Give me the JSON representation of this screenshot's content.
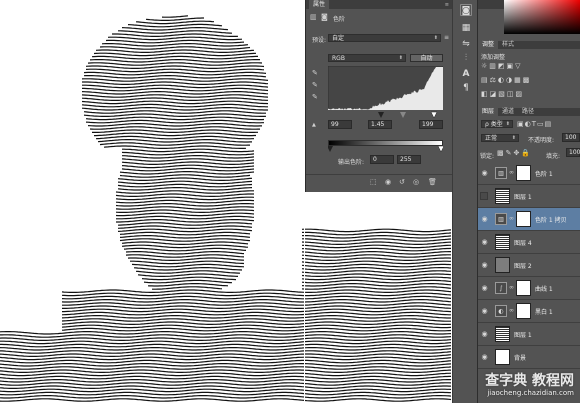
{
  "properties_panel": {
    "tab_label": "属性",
    "panel_icon_1": "adjustment-icon",
    "panel_icon_2": "mask-icon",
    "adjustment_name": "色阶",
    "preset_label": "预设:",
    "preset_value": "自定",
    "channel_value": "RGB",
    "auto_button": "自动",
    "input_black": "99",
    "input_gamma": "1.45",
    "input_white": "199",
    "output_label": "输出色阶:",
    "output_black": "0",
    "output_white": "255"
  },
  "adjustments_panel": {
    "tabs": [
      "调整",
      "样式"
    ],
    "add_label": "添加调整"
  },
  "layers_panel": {
    "tabs": [
      "图层",
      "通道",
      "路径"
    ],
    "filter_label": "ρ 类型",
    "blend_mode": "正常",
    "opacity_label": "不透明度:",
    "opacity_value": "100",
    "lock_label": "锁定:",
    "fill_label": "填充:",
    "fill_value": "100",
    "layers": [
      {
        "name": "色阶 1",
        "kind": "adjustment",
        "visible": true,
        "selected": false
      },
      {
        "name": "图层 1",
        "kind": "photo",
        "visible": false,
        "selected": false
      },
      {
        "name": "色阶 1 拷贝",
        "kind": "adjustment",
        "visible": true,
        "selected": true
      },
      {
        "name": "图层 4",
        "kind": "photo",
        "visible": true,
        "selected": false
      },
      {
        "name": "图层 2",
        "kind": "gray",
        "visible": true,
        "selected": false
      },
      {
        "name": "曲线 1",
        "kind": "curves",
        "visible": true,
        "selected": false
      },
      {
        "name": "黑白 1",
        "kind": "bw",
        "visible": true,
        "selected": false
      },
      {
        "name": "图层 1",
        "kind": "photo",
        "visible": true,
        "selected": false
      },
      {
        "name": "背景",
        "kind": "white",
        "visible": true,
        "selected": false
      }
    ]
  },
  "watermark": {
    "site_name": "查字典 教程网",
    "site_url": "jiaocheng.chazidian.com"
  },
  "colors": {
    "panel_bg": "#535353",
    "panel_dark": "#3d3d3d",
    "selection": "#5d7ea3"
  }
}
